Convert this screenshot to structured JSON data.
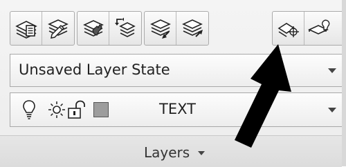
{
  "toolbar": {
    "buttons": [
      {
        "icon": "layer-properties-icon"
      },
      {
        "icon": "layer-match-icon"
      },
      {
        "icon": "layer-isolate-icon"
      },
      {
        "icon": "layer-previous-icon"
      },
      {
        "icon": "layer-make-current-icon"
      },
      {
        "icon": "layer-change-to-current-icon"
      },
      {
        "icon": "layer-unisolate-icon"
      },
      {
        "icon": "layer-off-icon"
      }
    ]
  },
  "layer_state": {
    "value": "Unsaved Layer State",
    "icon": "chevron-down-icon"
  },
  "layer_control": {
    "status_icons": [
      "lightbulb-icon",
      "sun-icon",
      "padlock-unlocked-icon"
    ],
    "color_swatch": "#9d9d9d",
    "current_layer": "TEXT",
    "icon": "chevron-down-icon"
  },
  "panel": {
    "title": "Layers",
    "expand_icon": "chevron-down-icon"
  },
  "colors": {
    "panel_background": "#ececec",
    "border": "#a8a8a8",
    "callout_arrow": "#000000"
  }
}
